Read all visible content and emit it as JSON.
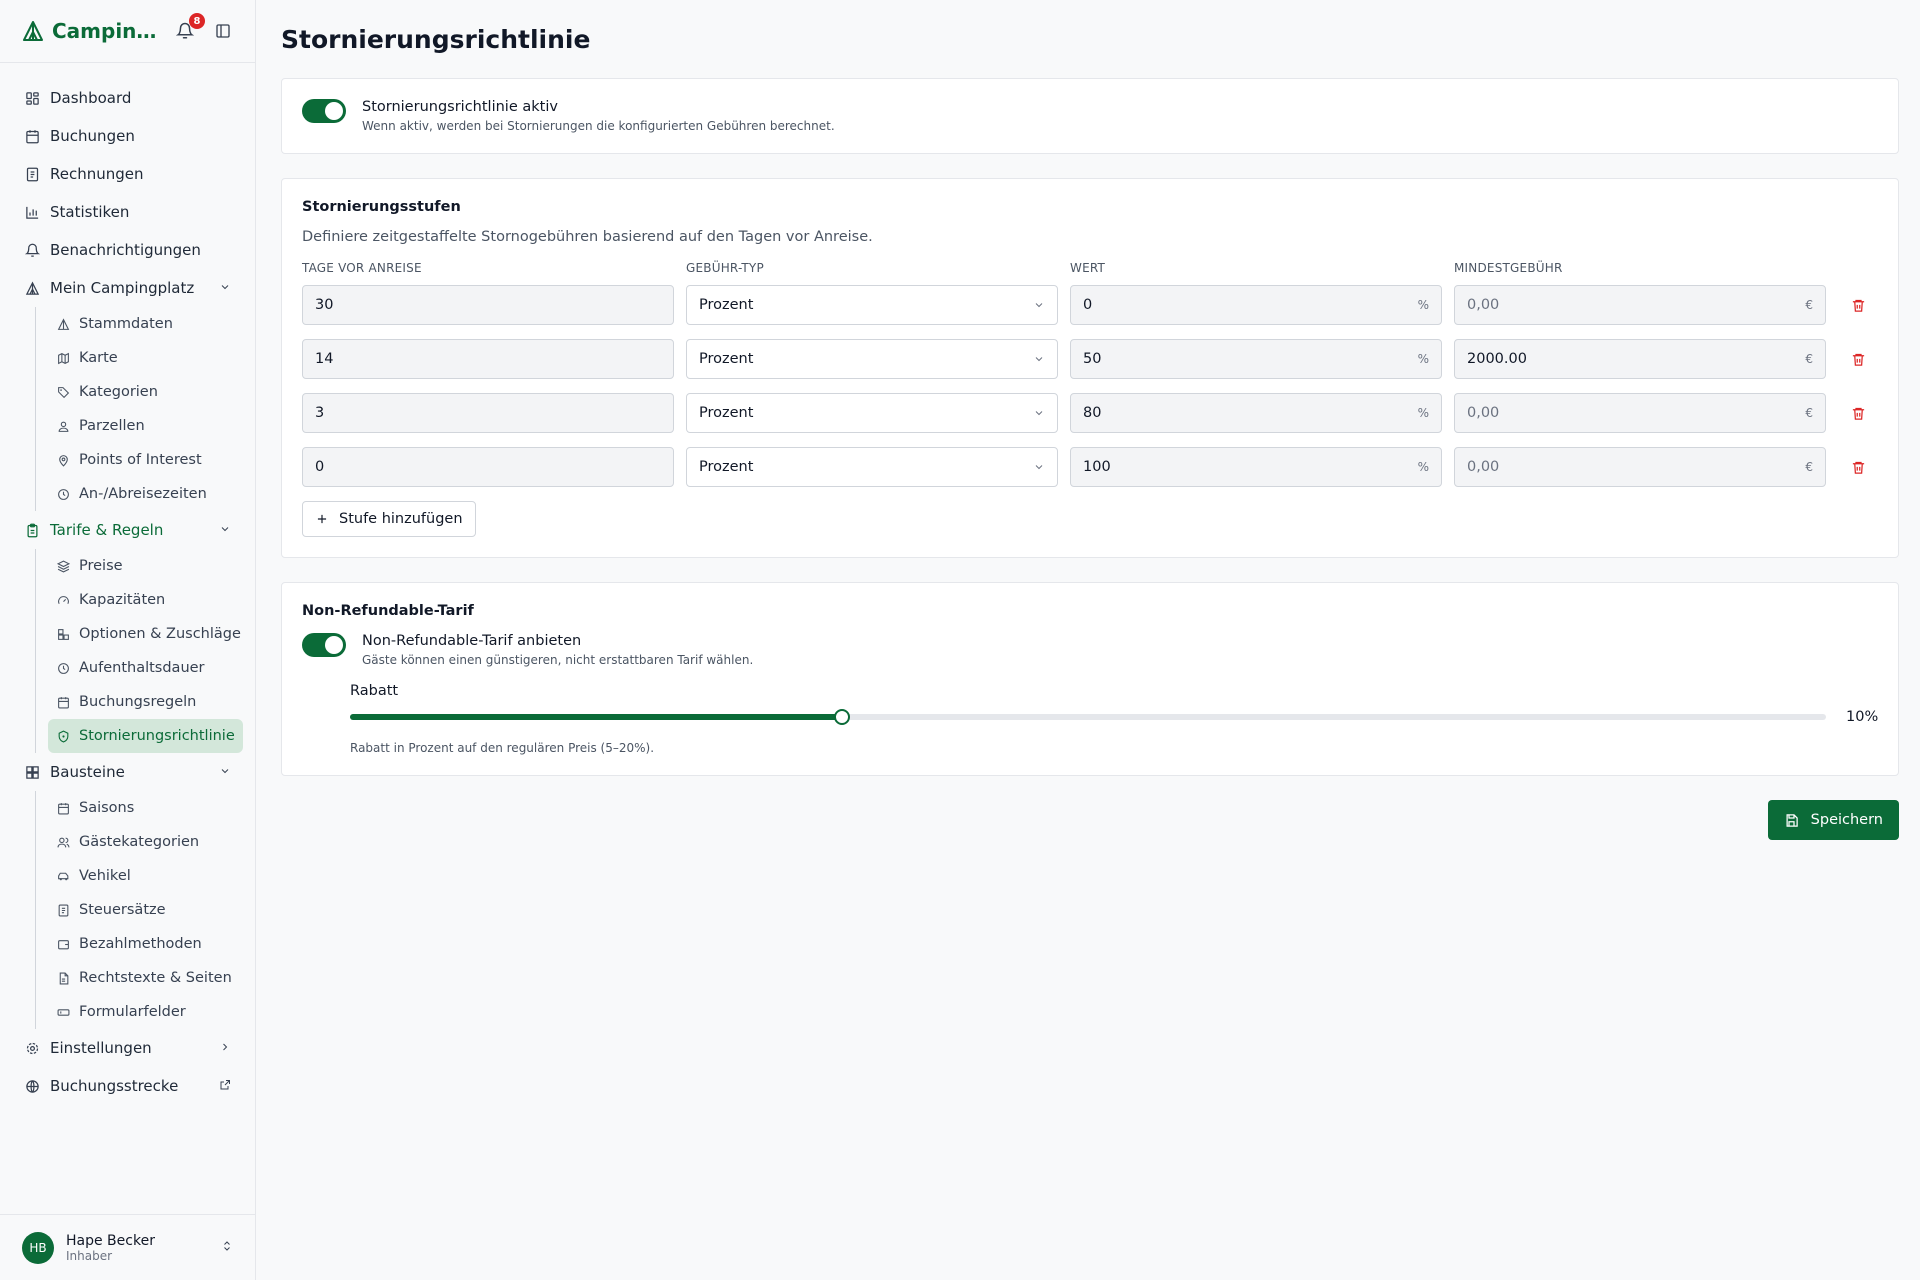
{
  "app": {
    "name": "Campin…",
    "notifications": "8"
  },
  "nav": {
    "dashboard": "Dashboard",
    "buchungen": "Buchungen",
    "rechnungen": "Rechnungen",
    "statistiken": "Statistiken",
    "benachrichtigungen": "Benachrichtigungen",
    "mein_campingplatz": "Mein Campingplatz",
    "mein_sub": [
      "Stammdaten",
      "Karte",
      "Kategorien",
      "Parzellen",
      "Points of Interest",
      "An-/Abreisezeiten"
    ],
    "tarife": "Tarife & Regeln",
    "tarife_sub": [
      "Preise",
      "Kapazitäten",
      "Optionen & Zuschläge",
      "Aufenthaltsdauer",
      "Buchungsregeln",
      "Stornierungsrichtlinie"
    ],
    "bausteine": "Bausteine",
    "bausteine_sub": [
      "Saisons",
      "Gästekategorien",
      "Vehikel",
      "Steuersätze",
      "Bezahlmethoden",
      "Rechtstexte & Seiten",
      "Formularfelder"
    ],
    "einstellungen": "Einstellungen",
    "buchungsstrecke": "Buchungsstrecke"
  },
  "user": {
    "initials": "HB",
    "name": "Hape Becker",
    "role": "Inhaber"
  },
  "page": {
    "title": "Stornierungsrichtlinie"
  },
  "policy": {
    "toggle_label": "Stornierungsrichtlinie aktiv",
    "toggle_desc": "Wenn aktiv, werden bei Stornierungen die konfigurierten Gebühren berechnet.",
    "enabled": true
  },
  "tiers": {
    "title": "Stornierungsstufen",
    "description": "Definiere zeitgestaffelte Stornogebühren basierend auf den Tagen vor Anreise.",
    "columns": [
      "Tage vor Anreise",
      "Gebühr-Typ",
      "Wert",
      "Mindestgebühr"
    ],
    "rows": [
      {
        "days": "30",
        "type": "Prozent",
        "value": "0",
        "unit": "%",
        "min_fee": "0,00",
        "currency": "€"
      },
      {
        "days": "14",
        "type": "Prozent",
        "value": "50",
        "unit": "%",
        "min_fee": "2000.00",
        "currency": "€"
      },
      {
        "days": "3",
        "type": "Prozent",
        "value": "80",
        "unit": "%",
        "min_fee": "0,00",
        "currency": "€"
      },
      {
        "days": "0",
        "type": "Prozent",
        "value": "100",
        "unit": "%",
        "min_fee": "0,00",
        "currency": "€"
      }
    ],
    "add_label": "Stufe hinzufügen"
  },
  "nonrefundable": {
    "title": "Non-Refundable-Tarif",
    "toggle_label": "Non-Refundable-Tarif anbieten",
    "toggle_desc": "Gäste können einen günstigeren, nicht erstattbaren Tarif wählen.",
    "enabled": true,
    "slider_label": "Rabatt",
    "slider_value": "10%",
    "slider_fraction": 0.333,
    "slider_hint": "Rabatt in Prozent auf den regulären Preis (5–20%)."
  },
  "actions": {
    "save": "Speichern"
  },
  "colors": {
    "accent": "#0b6b38",
    "danger": "#dc2626"
  }
}
